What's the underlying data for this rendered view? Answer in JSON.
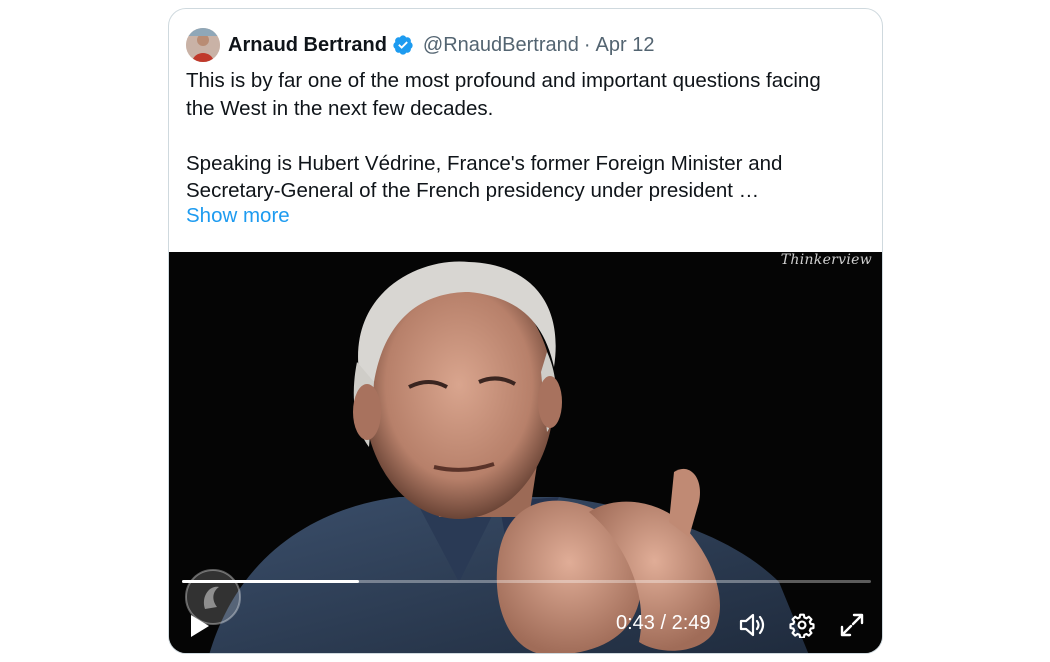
{
  "tweet": {
    "author": {
      "name": "Arnaud Bertrand",
      "handle": "@RnaudBertrand",
      "verified_icon": "verified-badge-icon",
      "avatar_icon": "avatar"
    },
    "separator": "·",
    "date": "Apr 12",
    "text_line_1": "This is by far one of the most profound and important questions facing",
    "text_line_2": "the West in the next few decades.",
    "text_line_3": "Speaking is Hubert Védrine, France's former Foreign Minister and",
    "text_line_4": "Secretary-General of the French presidency under president …",
    "show_more": "Show more"
  },
  "video": {
    "watermark": "Thinkerview",
    "progress": 0.257,
    "current_time": "0:43",
    "time_separator": " / ",
    "duration": "2:49",
    "controls": {
      "play": "play-icon",
      "volume": "volume-icon",
      "settings": "gear-icon",
      "fullscreen": "fullscreen-icon"
    }
  },
  "colors": {
    "link": "#1d9bf0",
    "verified": "#1d9bf0",
    "text": "#0f1419",
    "muted": "#536471",
    "border": "#cfd9de"
  }
}
